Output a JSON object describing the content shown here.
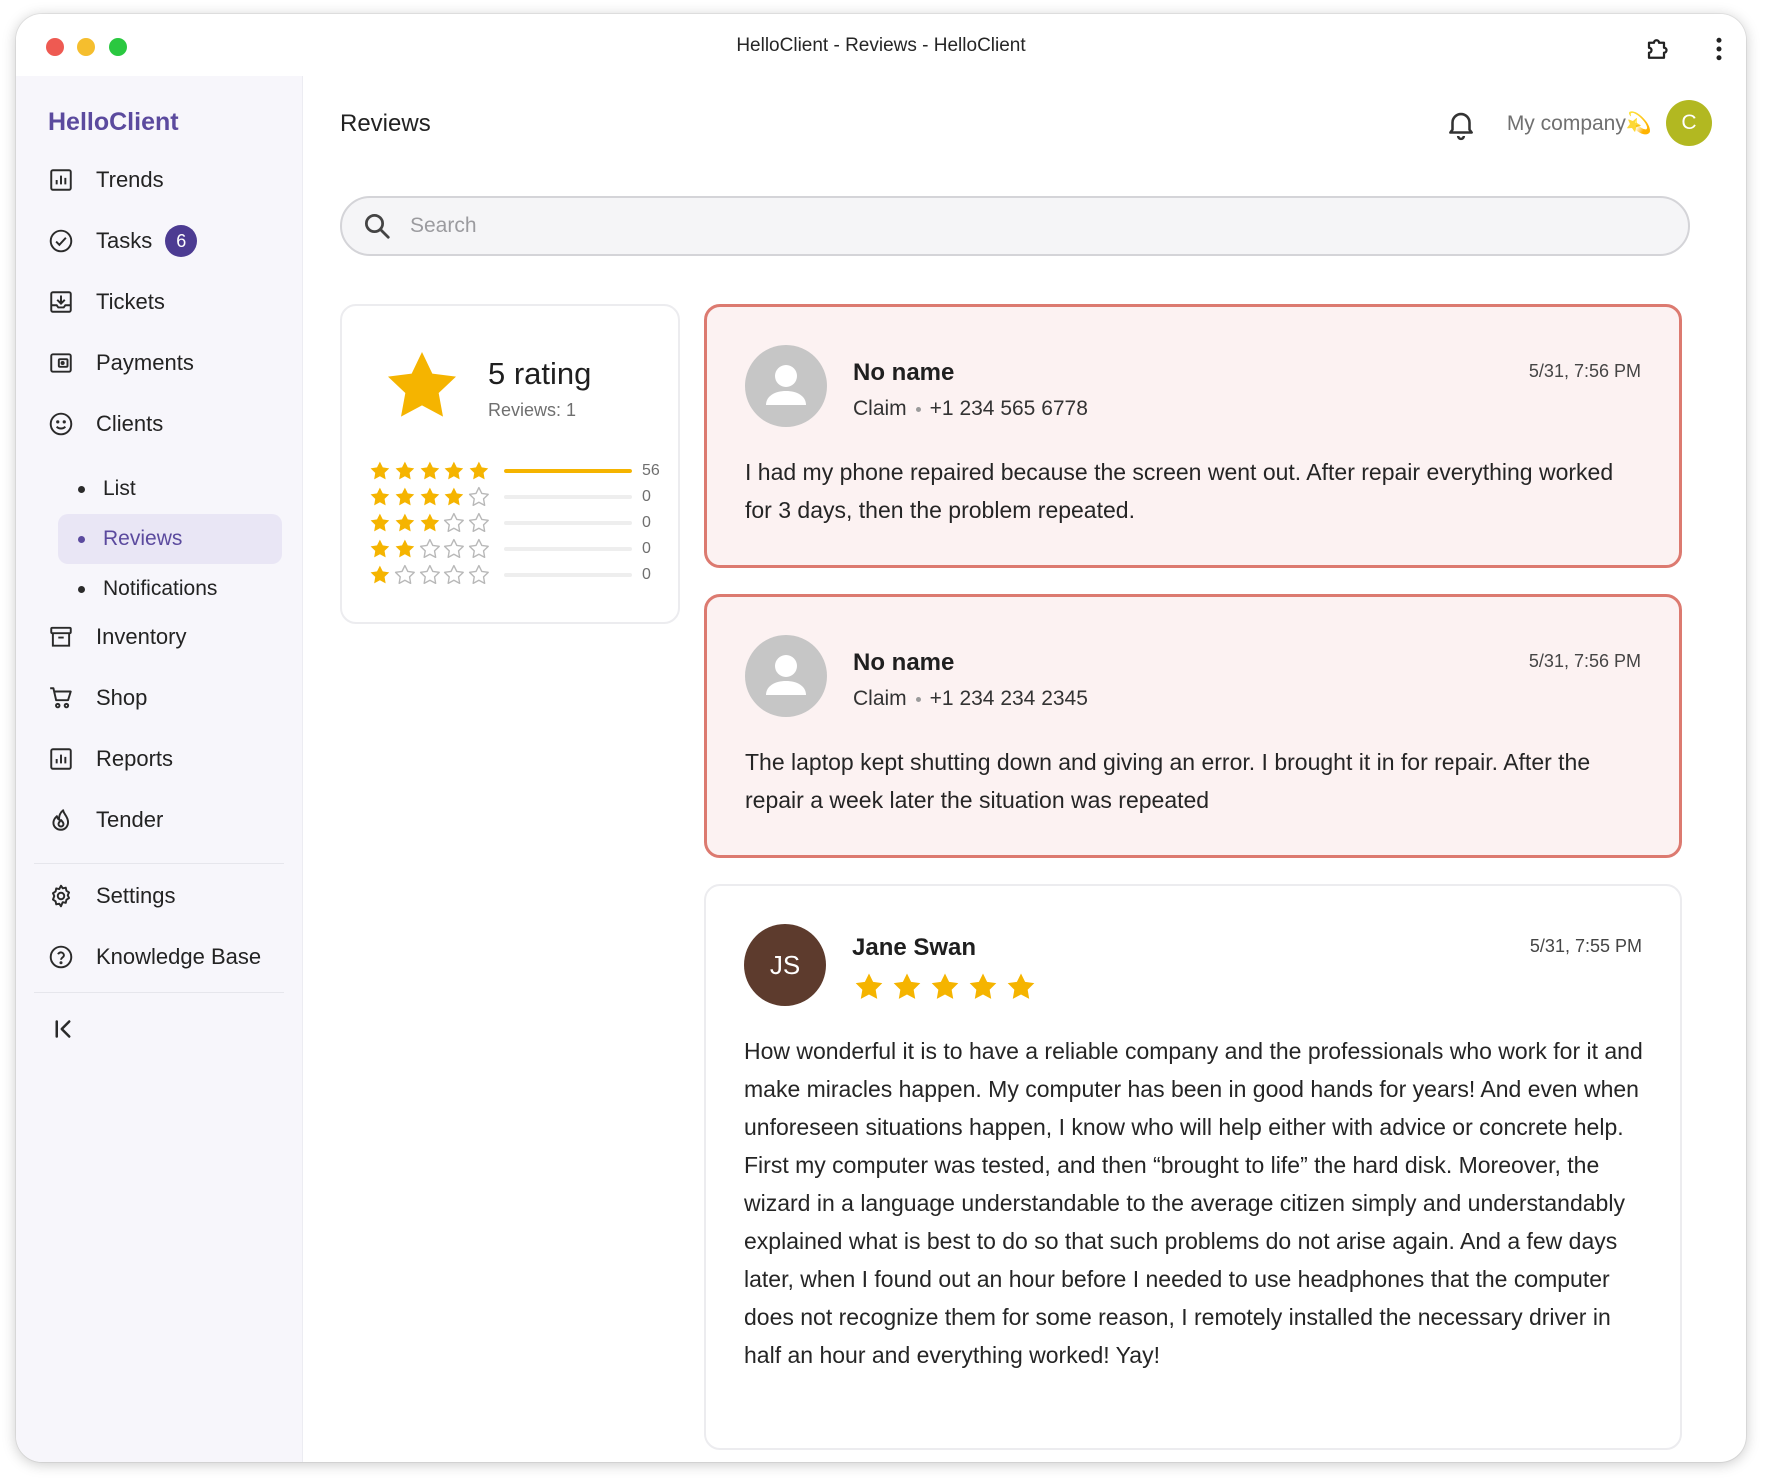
{
  "window": {
    "title": "HelloClient - Reviews - HelloClient"
  },
  "sidebar": {
    "brand": "HelloClient",
    "items": [
      {
        "label": "Trends",
        "icon": "chart-icon"
      },
      {
        "label": "Tasks",
        "icon": "check-circle-icon",
        "badge": "6"
      },
      {
        "label": "Tickets",
        "icon": "inbox-download-icon"
      },
      {
        "label": "Payments",
        "icon": "wallet-icon"
      },
      {
        "label": "Clients",
        "icon": "smile-icon"
      }
    ],
    "client_subitems": [
      {
        "label": "List"
      },
      {
        "label": "Reviews",
        "active": true
      },
      {
        "label": "Notifications"
      }
    ],
    "items_after": [
      {
        "label": "Inventory",
        "icon": "archive-icon"
      },
      {
        "label": "Shop",
        "icon": "cart-icon"
      },
      {
        "label": "Reports",
        "icon": "chart-icon"
      },
      {
        "label": "Tender",
        "icon": "flame-icon"
      }
    ],
    "bottom_items": [
      {
        "label": "Settings",
        "icon": "gear-icon"
      },
      {
        "label": "Knowledge Base",
        "icon": "help-circle-icon"
      }
    ]
  },
  "header": {
    "title": "Reviews",
    "company": "My company💫",
    "avatar_initial": "C",
    "avatar_color": "#b2b821"
  },
  "search": {
    "placeholder": "Search",
    "value": ""
  },
  "rating_summary": {
    "title": "5 rating",
    "reviews_label": "Reviews: 1",
    "distribution": [
      {
        "stars": 5,
        "count": "56",
        "fill": 1.0
      },
      {
        "stars": 4,
        "count": "0",
        "fill": 0
      },
      {
        "stars": 3,
        "count": "0",
        "fill": 0
      },
      {
        "stars": 2,
        "count": "0",
        "fill": 0
      },
      {
        "stars": 1,
        "count": "0",
        "fill": 0
      }
    ]
  },
  "reviews": [
    {
      "name": "No name",
      "date": "5/31, 7:56 PM",
      "type": "Claim",
      "phone": "+1 234 565 6778",
      "text": "I had my phone repaired because the screen went out. After repair everything worked for 3 days, then the problem repeated."
    },
    {
      "name": "No name",
      "date": "5/31, 7:56 PM",
      "type": "Claim",
      "phone": "+1 234 234 2345",
      "text": "The laptop kept shutting down and giving an error. I brought it in for repair. After the repair a week later the situation was repeated"
    },
    {
      "name": "Jane Swan",
      "initials": "JS",
      "date": "5/31, 7:55 PM",
      "stars": 5,
      "text": "How wonderful it is to have a reliable company and the professionals who work for it and make miracles happen. My computer has been in good hands for years! And even when unforeseen situations happen, I know who will help either with advice or concrete help. First my computer was tested, and then “brought to life” the hard disk. Moreover, the wizard in a language understandable to the average citizen simply and understandably explained what is best to do so that such problems do not arise again. And a few days later, when I found out an hour before I needed to use headphones that the computer does not recognize them for some reason, I remotely installed the necessary driver in half an hour and everything worked! Yay!"
    }
  ],
  "colors": {
    "brand": "#5b4a9e",
    "star": "#f5b400",
    "claim_border": "#dc7a70",
    "claim_bg": "#fcf2f2"
  }
}
